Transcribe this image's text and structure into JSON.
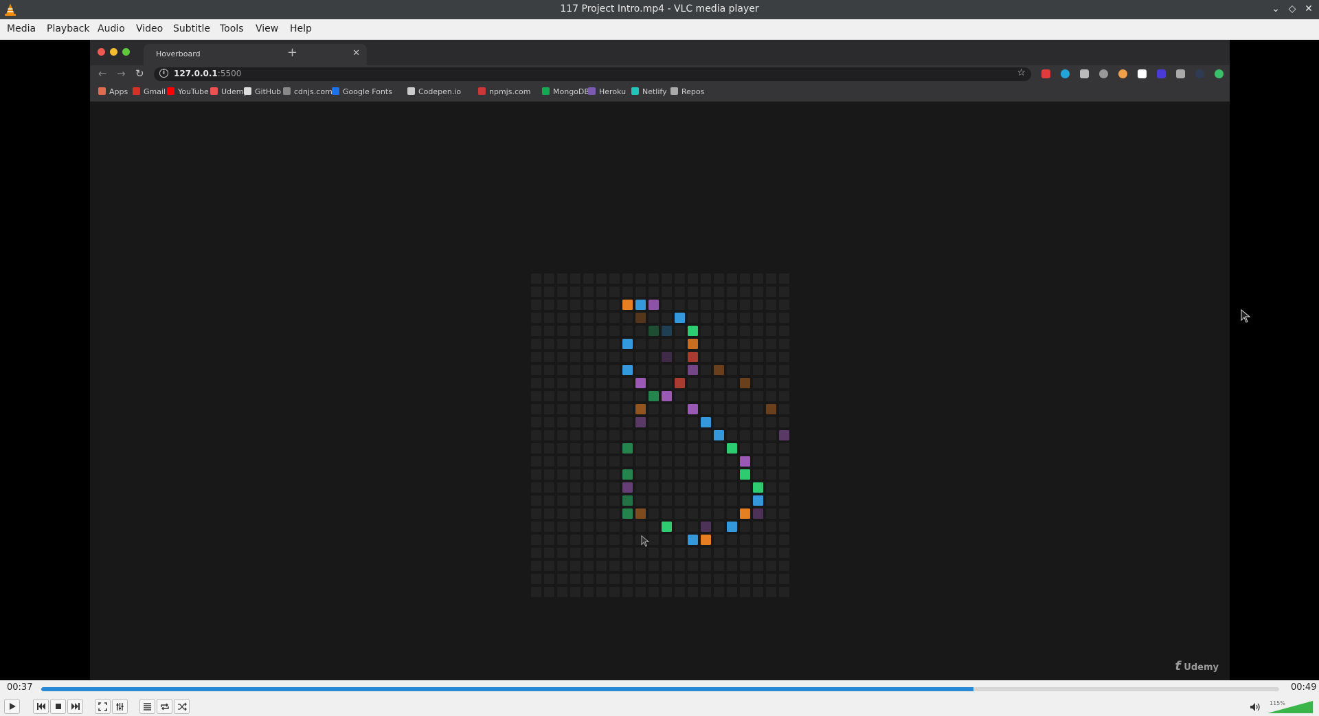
{
  "window": {
    "title": "117 Project Intro.mp4 - VLC media player"
  },
  "menu": [
    "Media",
    "Playback",
    "Audio",
    "Video",
    "Subtitle",
    "Tools",
    "View",
    "Help"
  ],
  "browser": {
    "tab_title": "Hoverboard",
    "url_host": "127.0.0.1",
    "url_port": ":5500",
    "bookmarks": [
      {
        "label": "Apps",
        "color": "#e06b50"
      },
      {
        "label": "Gmail",
        "color": "#d93025"
      },
      {
        "label": "YouTube",
        "color": "#ff0000"
      },
      {
        "label": "Udemy",
        "color": "#ec5252"
      },
      {
        "label": "GitHub",
        "color": "#dddddd"
      },
      {
        "label": "cdnjs.com",
        "color": "#888888"
      },
      {
        "label": "Google Fonts",
        "color": "#1a73e8"
      },
      {
        "label": "Codepen.io",
        "color": "#cccccc"
      },
      {
        "label": "npmjs.com",
        "color": "#cb3837"
      },
      {
        "label": "MongoDB",
        "color": "#13aa52"
      },
      {
        "label": "Heroku",
        "color": "#7b5bb0"
      },
      {
        "label": "Netlify",
        "color": "#20c6b7"
      },
      {
        "label": "Repos",
        "color": "#aaaaaa"
      }
    ],
    "watermark": "Udemy"
  },
  "hoverboard": {
    "grid_cols": 20,
    "grid_rows": 25,
    "empty_color": "#222222",
    "lit": [
      {
        "c": 7,
        "r": 2,
        "color": "#e67e22",
        "a": 1
      },
      {
        "c": 8,
        "r": 2,
        "color": "#3498db",
        "a": 1
      },
      {
        "c": 9,
        "r": 2,
        "color": "#9b59b6",
        "a": 0.9
      },
      {
        "c": 11,
        "r": 3,
        "color": "#3498db",
        "a": 1
      },
      {
        "c": 8,
        "r": 3,
        "color": "#e67e22",
        "a": 0.3
      },
      {
        "c": 9,
        "r": 4,
        "color": "#2ecc71",
        "a": 0.3
      },
      {
        "c": 10,
        "r": 4,
        "color": "#3498db",
        "a": 0.3
      },
      {
        "c": 12,
        "r": 4,
        "color": "#2ecc71",
        "a": 1
      },
      {
        "c": 7,
        "r": 5,
        "color": "#3498db",
        "a": 1
      },
      {
        "c": 12,
        "r": 5,
        "color": "#e67e22",
        "a": 0.85
      },
      {
        "c": 12,
        "r": 6,
        "color": "#e74c3c",
        "a": 0.7
      },
      {
        "c": 10,
        "r": 6,
        "color": "#9b59b6",
        "a": 0.3
      },
      {
        "c": 7,
        "r": 7,
        "color": "#3498db",
        "a": 1
      },
      {
        "c": 12,
        "r": 7,
        "color": "#9b59b6",
        "a": 0.7
      },
      {
        "c": 14,
        "r": 7,
        "color": "#e67e22",
        "a": 0.4
      },
      {
        "c": 8,
        "r": 8,
        "color": "#9b59b6",
        "a": 1
      },
      {
        "c": 11,
        "r": 8,
        "color": "#e74c3c",
        "a": 0.7
      },
      {
        "c": 16,
        "r": 8,
        "color": "#e67e22",
        "a": 0.4
      },
      {
        "c": 9,
        "r": 9,
        "color": "#2ecc71",
        "a": 0.6
      },
      {
        "c": 10,
        "r": 9,
        "color": "#9b59b6",
        "a": 1
      },
      {
        "c": 8,
        "r": 10,
        "color": "#e67e22",
        "a": 0.6
      },
      {
        "c": 12,
        "r": 10,
        "color": "#9b59b6",
        "a": 1
      },
      {
        "c": 18,
        "r": 10,
        "color": "#e67e22",
        "a": 0.4
      },
      {
        "c": 8,
        "r": 11,
        "color": "#9b59b6",
        "a": 0.5
      },
      {
        "c": 13,
        "r": 11,
        "color": "#3498db",
        "a": 1
      },
      {
        "c": 14,
        "r": 12,
        "color": "#3498db",
        "a": 1
      },
      {
        "c": 19,
        "r": 12,
        "color": "#9b59b6",
        "a": 0.5
      },
      {
        "c": 7,
        "r": 13,
        "color": "#2ecc71",
        "a": 0.6
      },
      {
        "c": 15,
        "r": 13,
        "color": "#2ecc71",
        "a": 1
      },
      {
        "c": 16,
        "r": 14,
        "color": "#9b59b6",
        "a": 1
      },
      {
        "c": 7,
        "r": 15,
        "color": "#2ecc71",
        "a": 0.6
      },
      {
        "c": 16,
        "r": 15,
        "color": "#2ecc71",
        "a": 1
      },
      {
        "c": 7,
        "r": 16,
        "color": "#9b59b6",
        "a": 0.6
      },
      {
        "c": 17,
        "r": 16,
        "color": "#2ecc71",
        "a": 1
      },
      {
        "c": 7,
        "r": 17,
        "color": "#2ecc71",
        "a": 0.5
      },
      {
        "c": 17,
        "r": 17,
        "color": "#3498db",
        "a": 1
      },
      {
        "c": 7,
        "r": 18,
        "color": "#2ecc71",
        "a": 0.6
      },
      {
        "c": 8,
        "r": 18,
        "color": "#e67e22",
        "a": 0.5
      },
      {
        "c": 16,
        "r": 18,
        "color": "#e67e22",
        "a": 1
      },
      {
        "c": 17,
        "r": 18,
        "color": "#9b59b6",
        "a": 0.4
      },
      {
        "c": 10,
        "r": 19,
        "color": "#2ecc71",
        "a": 1
      },
      {
        "c": 13,
        "r": 19,
        "color": "#9b59b6",
        "a": 0.4
      },
      {
        "c": 15,
        "r": 19,
        "color": "#3498db",
        "a": 1
      },
      {
        "c": 12,
        "r": 20,
        "color": "#3498db",
        "a": 1
      },
      {
        "c": 13,
        "r": 20,
        "color": "#e67e22",
        "a": 1
      }
    ]
  },
  "player": {
    "elapsed": "00:37",
    "duration": "00:49",
    "progress_fraction": 0.753,
    "volume_label": "115%",
    "volume_fraction": 1.0,
    "accent_color": "#2b8ad8"
  },
  "icons": {
    "play": "play-icon",
    "previous": "skip-back-icon",
    "stop": "stop-icon",
    "next": "skip-forward-icon",
    "fullscreen": "fullscreen-icon",
    "extended": "equalizer-icon",
    "playlist": "playlist-icon",
    "loop": "loop-icon",
    "shuffle": "shuffle-icon",
    "speaker": "speaker-icon"
  }
}
